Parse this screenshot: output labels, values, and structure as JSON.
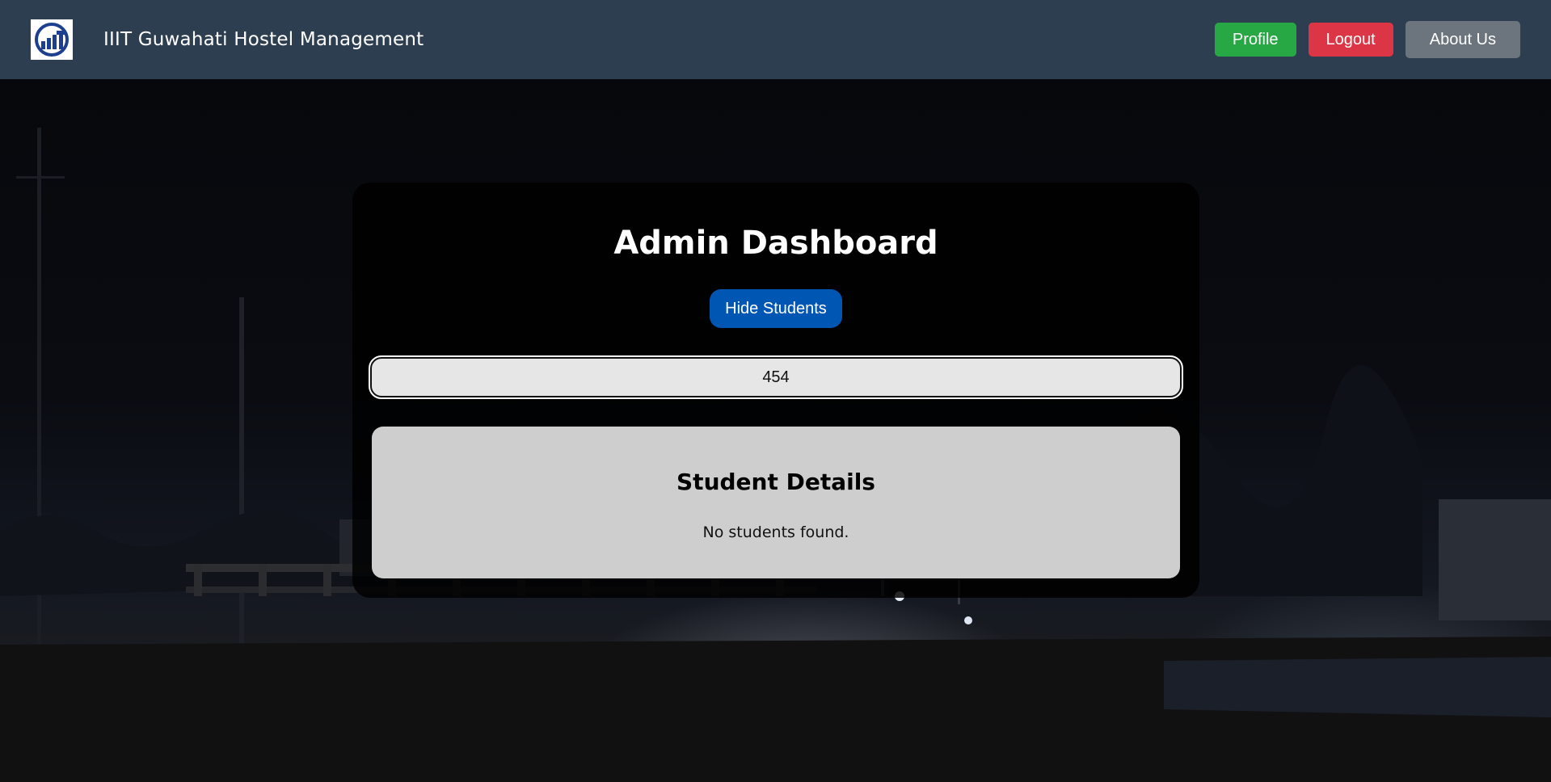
{
  "navbar": {
    "logo_icon": "iiitg-logo-icon",
    "title": "IIIT Guwahati Hostel Management",
    "profile_label": "Profile",
    "logout_label": "Logout",
    "about_label": "About Us"
  },
  "dashboard": {
    "title": "Admin Dashboard",
    "toggle_label": "Hide Students",
    "search_value": "454",
    "details_title": "Student Details",
    "empty_message": "No students found."
  },
  "colors": {
    "navbar_bg": "#2c3e50",
    "profile_btn": "#28a745",
    "logout_btn": "#dc3545",
    "about_btn": "#6c757d",
    "primary_btn": "#0056b3"
  }
}
